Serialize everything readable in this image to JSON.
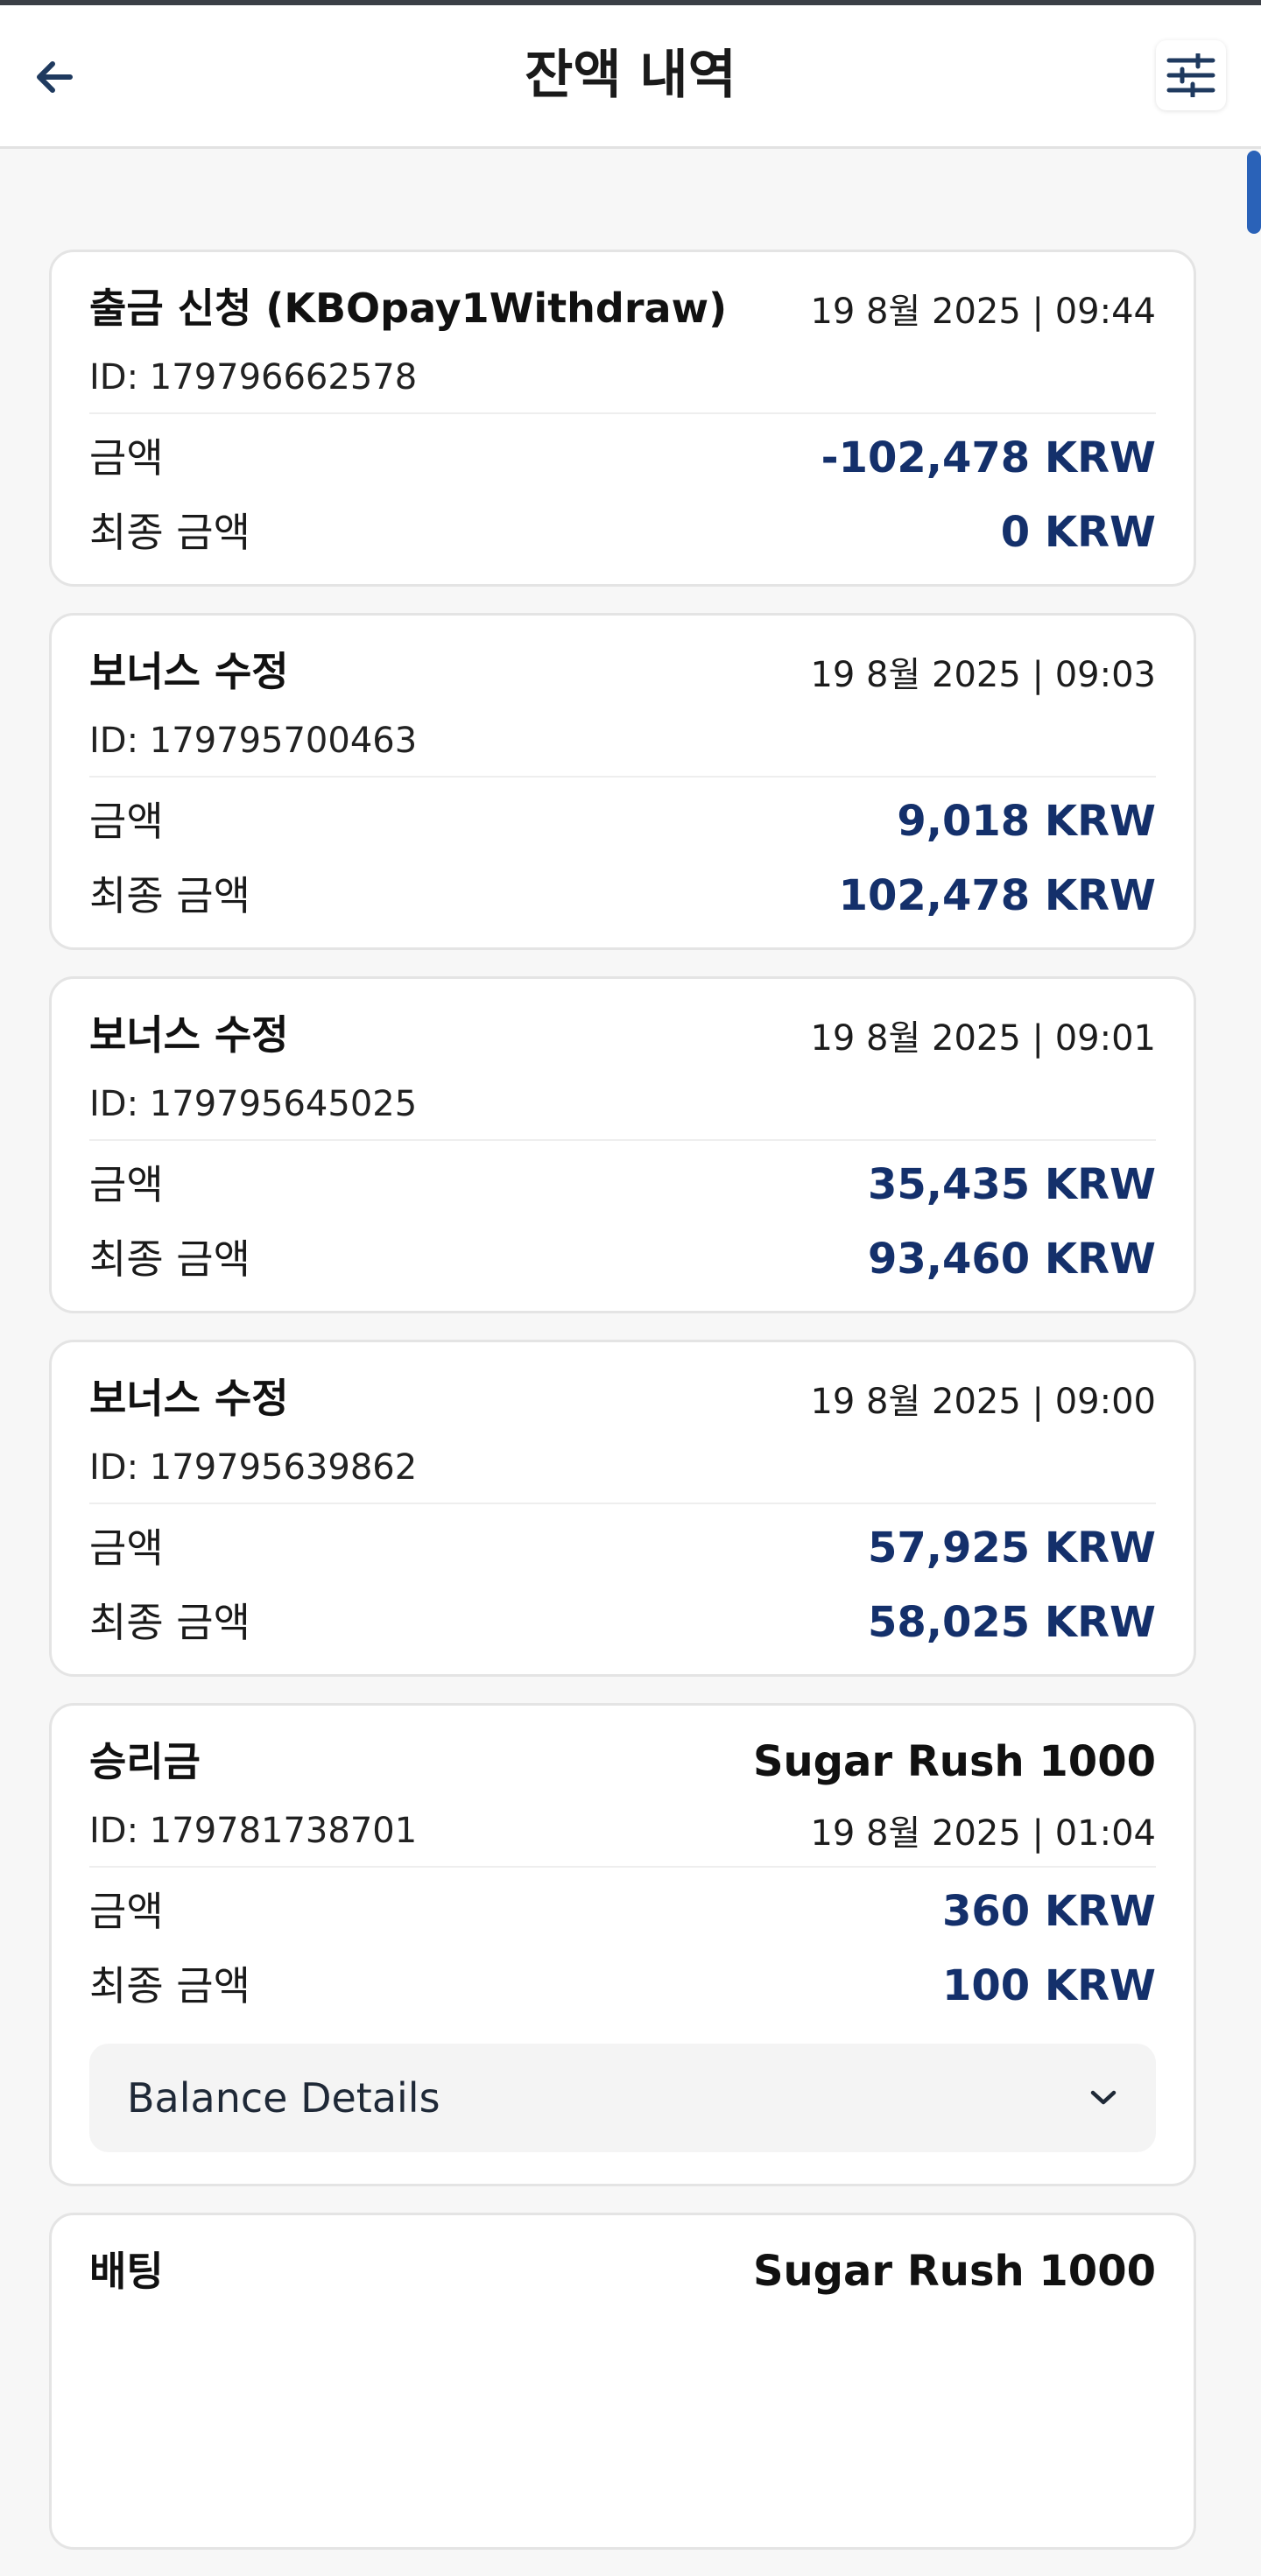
{
  "header": {
    "title": "잔액 내역",
    "back_icon": "arrow-left-icon",
    "filter_icon": "sliders-icon"
  },
  "transactions": [
    {
      "title": "출금 신청 (KBOpay1Withdraw)",
      "date": "19 8월 2025 | 09:44",
      "id": "ID: 179796662578",
      "amount_label": "금액",
      "amount": "-102,478 KRW",
      "final_label": "최종 금액",
      "final": "0 KRW"
    },
    {
      "title": "보너스 수정",
      "date": "19 8월 2025 | 09:03",
      "id": "ID: 179795700463",
      "amount_label": "금액",
      "amount": "9,018 KRW",
      "final_label": "최종 금액",
      "final": "102,478 KRW"
    },
    {
      "title": "보너스 수정",
      "date": "19 8월 2025 | 09:01",
      "id": "ID: 179795645025",
      "amount_label": "금액",
      "amount": "35,435 KRW",
      "final_label": "최종 금액",
      "final": "93,460 KRW"
    },
    {
      "title": "보너스 수정",
      "date": "19 8월 2025 | 09:00",
      "id": "ID: 179795639862",
      "amount_label": "금액",
      "amount": "57,925 KRW",
      "final_label": "최종 금액",
      "final": "58,025 KRW"
    },
    {
      "title": "승리금",
      "game": "Sugar Rush 1000",
      "date": "19 8월 2025 | 01:04",
      "id": "ID: 179781738701",
      "amount_label": "금액",
      "amount": "360 KRW",
      "final_label": "최종 금액",
      "final": "100 KRW",
      "details_label": "Balance Details",
      "details_icon": "chevron-down-icon"
    },
    {
      "title": "배팅",
      "game": "Sugar Rush 1000"
    }
  ],
  "colors": {
    "value_text": "#14306b",
    "accent": "#2a62b8",
    "background": "#f7f7f7"
  }
}
